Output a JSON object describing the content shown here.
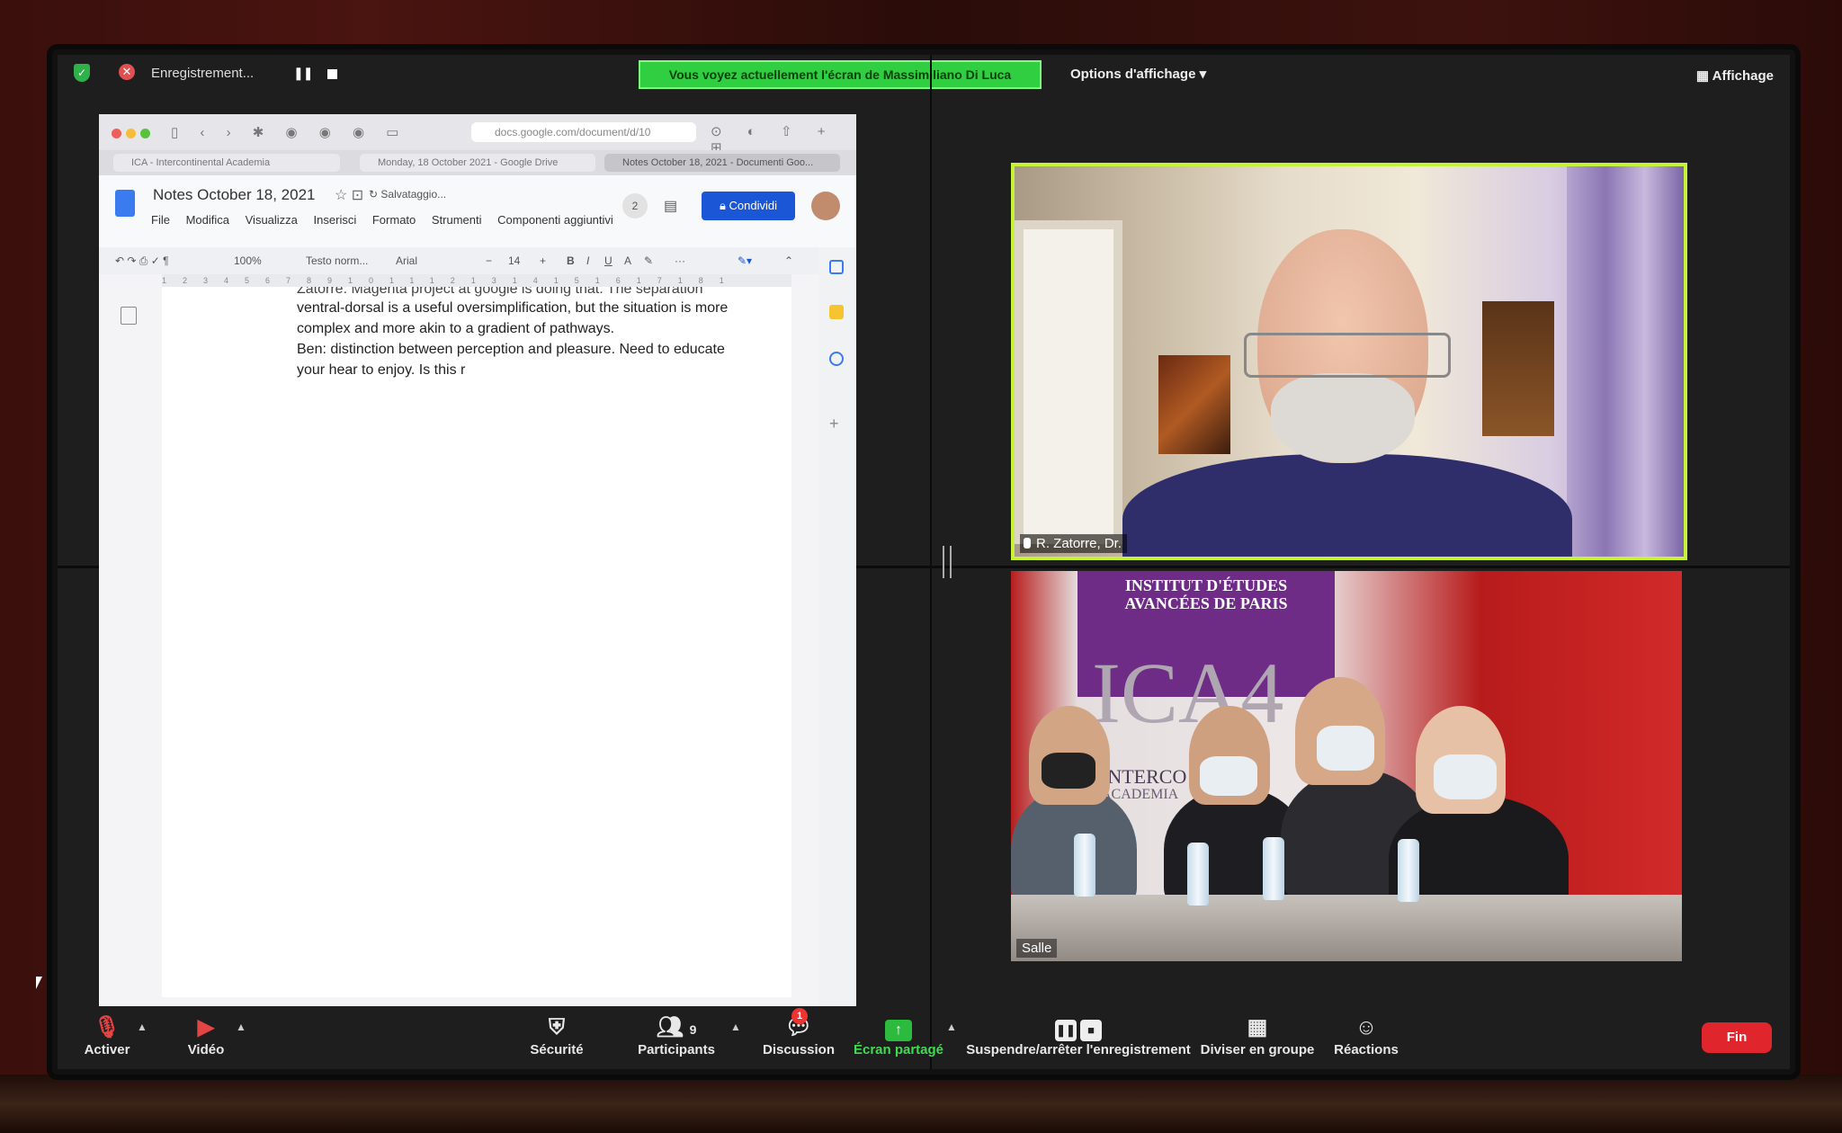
{
  "zoom": {
    "recording_label": "Enregistrement...",
    "share_banner": "Vous voyez actuellement l'écran de Massimiliano Di Luca",
    "view_options": "Options d'affichage",
    "view_button": "Affichage"
  },
  "browser": {
    "url": "docs.google.com/document/d/10",
    "tabs": [
      {
        "label": "ICA - Intercontinental Academia"
      },
      {
        "label": "Monday, 18 October 2021 - Google Drive"
      },
      {
        "label": "Notes October 18, 2021 - Documenti Goo..."
      }
    ]
  },
  "doc": {
    "title": "Notes October 18, 2021",
    "saving": "Salvataggio...",
    "menus": [
      "File",
      "Modifica",
      "Visualizza",
      "Inserisci",
      "Formato",
      "Strumenti",
      "Componenti aggiuntivi"
    ],
    "comment_count": "2",
    "share_button": "Condividi",
    "toolbar": {
      "zoom": "100%",
      "style": "Testo norm...",
      "font": "Arial",
      "size": "14"
    },
    "lines": [
      "Zatorre: Magenta project at google is doing that. The separation",
      "ventral-dorsal is a useful oversimplification, but the situation is more",
      "complex and more akin to a gradient of pathways.",
      "Ben: distinction between perception and pleasure. Need to educate",
      "your hear to enjoy. Is this r"
    ]
  },
  "participants": {
    "speaker_name": "R. Zatorre, Dr.",
    "room_name": "Salle",
    "room_banner_line1": "INSTITUT D'ÉTUDES",
    "room_banner_line2": "AVANCÉES DE PARIS",
    "room_logo": "ICA4",
    "room_logo_sub": "INTERCO",
    "room_logo_sub2": "ACADEMIA"
  },
  "bottombar": {
    "mute_label": "Activer",
    "video_label": "Vidéo",
    "security_label": "Sécurité",
    "participants_label": "Participants",
    "participants_count": "9",
    "chat_label": "Discussion",
    "chat_badge": "1",
    "share_label": "Écran partagé",
    "record_label": "Suspendre/arrêter l'enregistrement",
    "breakout_label": "Diviser en groupe",
    "reactions_label": "Réactions",
    "end_label": "Fin"
  },
  "colors": {
    "share_green": "#2fcf41",
    "active_speaker_border": "#c7f23a",
    "end_red": "#e0262c",
    "docs_blue": "#1a56d6"
  }
}
